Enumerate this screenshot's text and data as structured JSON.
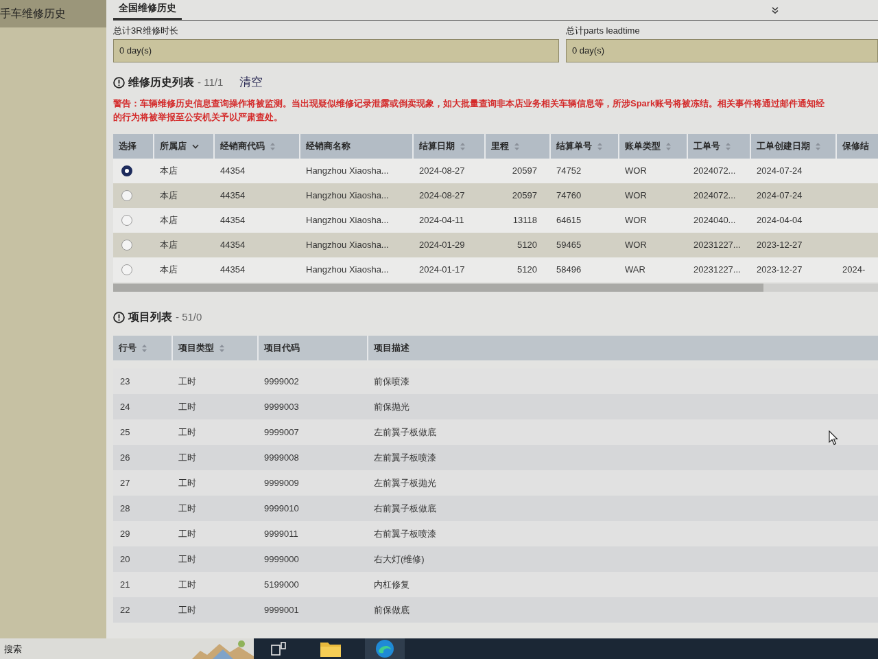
{
  "sidebar": {
    "items": [
      {
        "label": "手车维修历史",
        "selected": true
      }
    ]
  },
  "tabs": [
    {
      "label": "全国维修历史",
      "selected": true
    }
  ],
  "summary": [
    {
      "label": "总计3R维修时长",
      "value": "0 day(s)"
    },
    {
      "label": "总计parts leadtime",
      "value": "0 day(s)"
    }
  ],
  "history": {
    "title": "维修历史列表",
    "count": "- 11/1",
    "clear_button": "清空",
    "warning_lines": [
      "警告：车辆维修历史信息查询操作将被监测。当出现疑似维修记录泄露或倒卖现象，如大批量查询非本店业务相关车辆信息等，所涉Spark账号将被冻结。相关事件将通过邮件通知经",
      "的行为将被举报至公安机关予以严肃查处。"
    ],
    "table": {
      "select_column": {
        "label": "选择"
      },
      "columns": [
        {
          "label": "所属店",
          "kind": "text",
          "sortable": false,
          "dropdown": true
        },
        {
          "label": "经销商代码",
          "kind": "text",
          "sortable": true,
          "dropdown": false
        },
        {
          "label": "经销商名称",
          "kind": "text",
          "sortable": false,
          "dropdown": false
        },
        {
          "label": "结算日期",
          "kind": "text",
          "sortable": true,
          "dropdown": false
        },
        {
          "label": "里程",
          "kind": "number",
          "sortable": true,
          "dropdown": false
        },
        {
          "label": "结算单号",
          "kind": "text",
          "sortable": true,
          "dropdown": false
        },
        {
          "label": "账单类型",
          "kind": "text",
          "sortable": true,
          "dropdown": false
        },
        {
          "label": "工单号",
          "kind": "text",
          "sortable": true,
          "dropdown": false
        },
        {
          "label": "工单创建日期",
          "kind": "text",
          "sortable": true,
          "dropdown": false
        },
        {
          "label": "保修结",
          "kind": "text",
          "sortable": false,
          "dropdown": false
        }
      ],
      "rows": [
        {
          "selected": true,
          "cells": [
            "本店",
            "44354",
            "Hangzhou Xiaosha...",
            "2024-08-27",
            "20597",
            "74752",
            "WOR",
            "2024072...",
            "2024-07-24"
          ]
        },
        {
          "selected": false,
          "cells": [
            "本店",
            "44354",
            "Hangzhou Xiaosha...",
            "2024-08-27",
            "20597",
            "74760",
            "WOR",
            "2024072...",
            "2024-07-24"
          ]
        },
        {
          "selected": false,
          "cells": [
            "本店",
            "44354",
            "Hangzhou Xiaosha...",
            "2024-04-11",
            "13118",
            "64615",
            "WOR",
            "2024040...",
            "2024-04-04"
          ]
        },
        {
          "selected": false,
          "cells": [
            "本店",
            "44354",
            "Hangzhou Xiaosha...",
            "2024-01-29",
            "5120",
            "59465",
            "WOR",
            "20231227...",
            "2023-12-27"
          ]
        },
        {
          "selected": false,
          "cells": [
            "本店",
            "44354",
            "Hangzhou Xiaosha...",
            "2024-01-17",
            "5120",
            "58496",
            "WAR",
            "20231227...",
            "2023-12-27",
            "2024-"
          ]
        }
      ]
    }
  },
  "items": {
    "title": "项目列表",
    "count": "- 51/0",
    "table": {
      "columns": [
        {
          "label": "行号",
          "kind": "text",
          "sortable": true,
          "dropdown": false
        },
        {
          "label": "项目类型",
          "kind": "text",
          "sortable": true,
          "dropdown": false
        },
        {
          "label": "项目代码",
          "kind": "text",
          "sortable": false,
          "dropdown": false
        },
        {
          "label": "项目描述",
          "kind": "text",
          "sortable": false,
          "dropdown": false
        }
      ],
      "rows": [
        {
          "cells": [
            "23",
            "工时",
            "9999002",
            "前保喷漆"
          ]
        },
        {
          "cells": [
            "24",
            "工时",
            "9999003",
            "前保抛光"
          ]
        },
        {
          "cells": [
            "25",
            "工时",
            "9999007",
            "左前翼子板做底"
          ]
        },
        {
          "cells": [
            "26",
            "工时",
            "9999008",
            "左前翼子板喷漆"
          ]
        },
        {
          "cells": [
            "27",
            "工时",
            "9999009",
            "左前翼子板抛光"
          ]
        },
        {
          "cells": [
            "28",
            "工时",
            "9999010",
            "右前翼子板做底"
          ]
        },
        {
          "cells": [
            "29",
            "工时",
            "9999011",
            "右前翼子板喷漆"
          ]
        },
        {
          "cells": [
            "20",
            "工时",
            "9999000",
            "右大灯(维修)"
          ]
        },
        {
          "cells": [
            "21",
            "工时",
            "5199000",
            "内杠修复"
          ]
        },
        {
          "cells": [
            "22",
            "工时",
            "9999001",
            "前保做底"
          ]
        }
      ]
    }
  },
  "taskbar": {
    "search": {
      "placeholder": "搜索"
    }
  }
}
